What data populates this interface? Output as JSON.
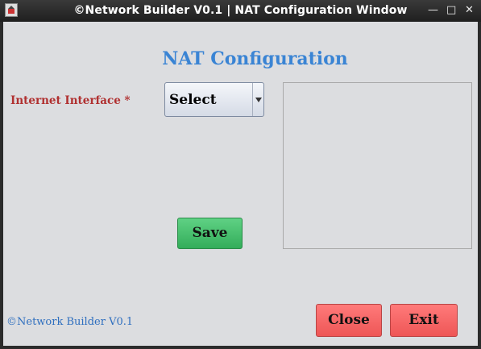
{
  "window": {
    "title": "©Network Builder V0.1 | NAT Configuration Window",
    "minimize_glyph": "—",
    "maximize_glyph": "□",
    "close_glyph": "✕"
  },
  "form": {
    "heading": "NAT Configuration",
    "interface_label": "Internet Interface *",
    "interface_select_value": "Select",
    "save_label": "Save"
  },
  "footer": {
    "copyright": "©Network Builder V0.1"
  },
  "actions": {
    "close_label": "Close",
    "exit_label": "Exit"
  },
  "colors": {
    "heading": "#3a84d4",
    "required_label": "#b03030",
    "save_button": "#3fbd68",
    "danger_button": "#f56464",
    "footer_text": "#2f6fbf",
    "panel_background": "#dcdde0"
  }
}
